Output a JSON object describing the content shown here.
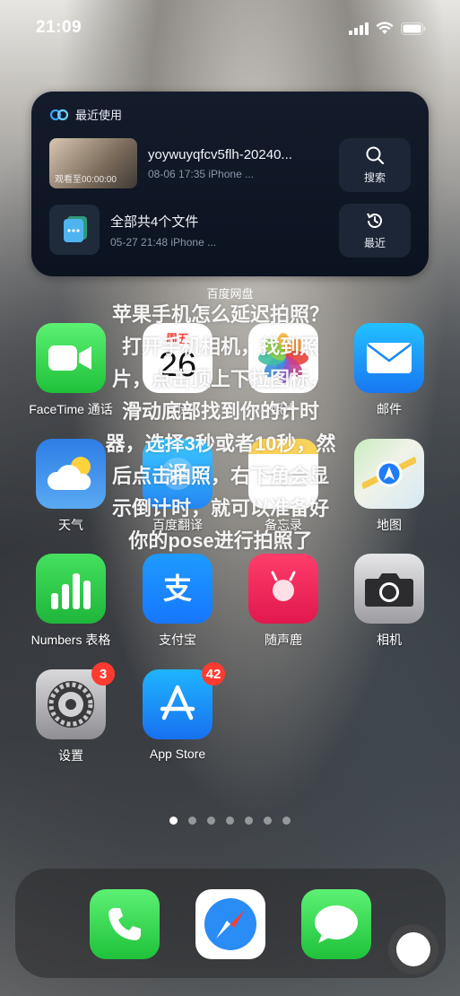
{
  "status": {
    "time": "21:09"
  },
  "widget": {
    "header": "最近使用",
    "recent1": {
      "title": "yoywuyqfcv5flh-20240...",
      "subtitle": "08-06 17:35 iPhone ...",
      "thumb_caption": "观看至00:00:00"
    },
    "recent2": {
      "title": "全部共4个文件",
      "subtitle": "05-27 21:48 iPhone ..."
    },
    "search_label": "搜索",
    "recent_label": "最近",
    "name": "百度网盘"
  },
  "apps": {
    "facetime": "FaceTime 通话",
    "calendar": "日历",
    "calendar_weekday": "周五",
    "calendar_day": "26",
    "photos": "照片",
    "mail": "邮件",
    "weather": "天气",
    "translate": "百度翻译",
    "memo": "备忘录",
    "maps": "地图",
    "numbers": "Numbers 表格",
    "alipay": "支付宝",
    "suishouji": "随声鹿",
    "camera": "相机",
    "settings": "设置",
    "settings_badge": "3",
    "appstore": "App Store",
    "appstore_badge": "42"
  },
  "overlay_text": "苹果手机怎么延迟拍照？\n打开手机相机，找到照片，点击顶上下拉图标，滑动底部找到你的计时器，选择3秒或者10秒，然后点击拍照，右下角会显示倒计时，就可以准备好你的pose进行拍照了",
  "colors": {
    "badge": "#ff3b30",
    "widget_bg": "#0b1220"
  }
}
